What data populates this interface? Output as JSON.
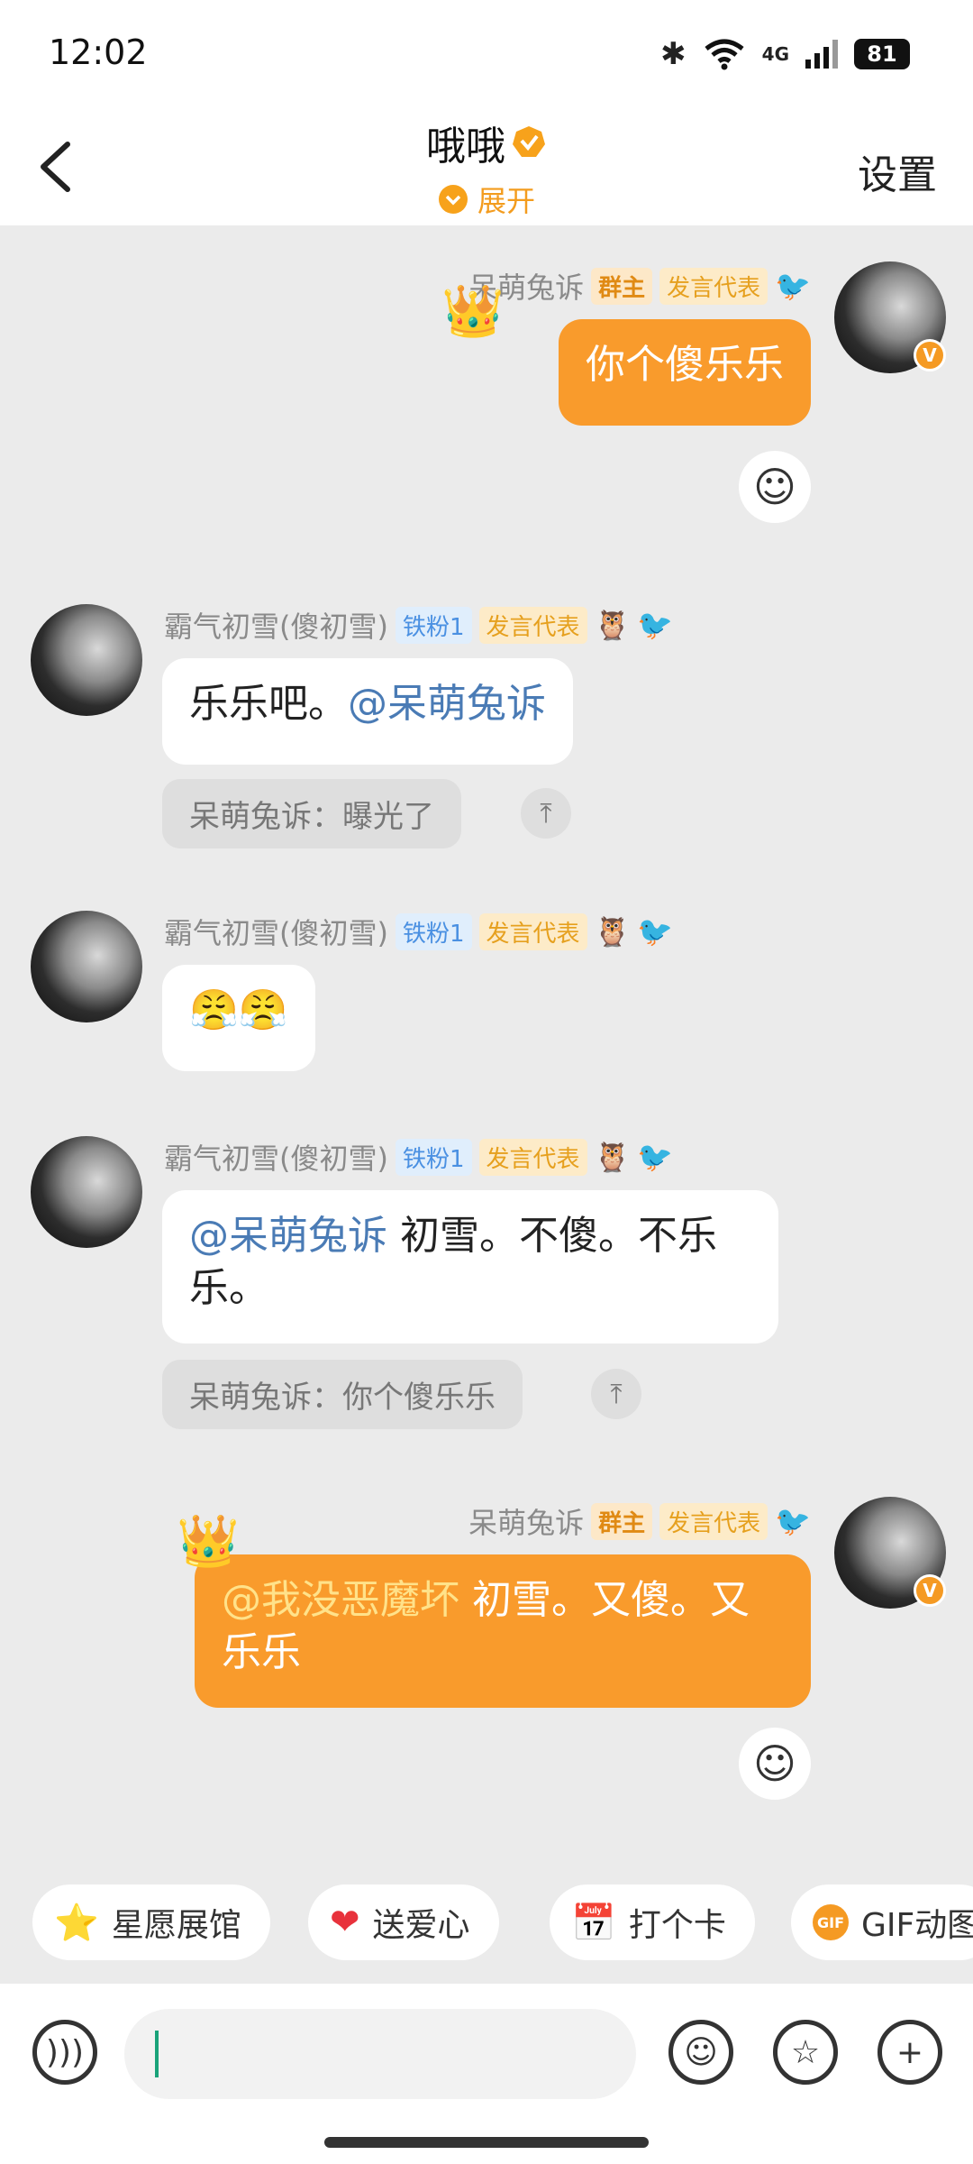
{
  "status_bar": {
    "time": "12:02",
    "battery": "81",
    "network": "4G"
  },
  "header": {
    "title": "哦哦",
    "subtitle": "展开",
    "settings": "设置"
  },
  "messages": [
    {
      "sender": "呆萌兔诉",
      "badge1": "群主",
      "badge2": "发言代表",
      "text": "你个傻乐乐"
    },
    {
      "sender": "霸气初雪(傻初雪)",
      "fan": "铁粉1",
      "badge2": "发言代表",
      "mention": "@呆萌兔诉",
      "text": "乐乐吧。",
      "quote": "呆萌兔诉：曝光了"
    },
    {
      "sender": "霸气初雪(傻初雪)",
      "fan": "铁粉1",
      "badge2": "发言代表",
      "text": "😤😤"
    },
    {
      "sender": "霸气初雪(傻初雪)",
      "fan": "铁粉1",
      "badge2": "发言代表",
      "mention": "@呆萌兔诉",
      "text": " 初雪。不傻。不乐乐。",
      "quote": "呆萌兔诉：你个傻乐乐"
    },
    {
      "sender": "呆萌兔诉",
      "badge1": "群主",
      "badge2": "发言代表",
      "mention": "@我没恶魔坏",
      "text": " 初雪。又傻。又乐乐"
    }
  ],
  "quick_actions": [
    {
      "label": "星愿展馆",
      "icon": "star-icon"
    },
    {
      "label": "送爱心",
      "icon": "heart-icon"
    },
    {
      "label": "打个卡",
      "icon": "checkin-icon"
    },
    {
      "label": "GIF动图",
      "icon": "gif-icon"
    }
  ],
  "composer": {
    "placeholder": ""
  },
  "colors": {
    "accent": "#f99b2c",
    "mention": "#4a7bb5",
    "background": "#ebebeb"
  }
}
